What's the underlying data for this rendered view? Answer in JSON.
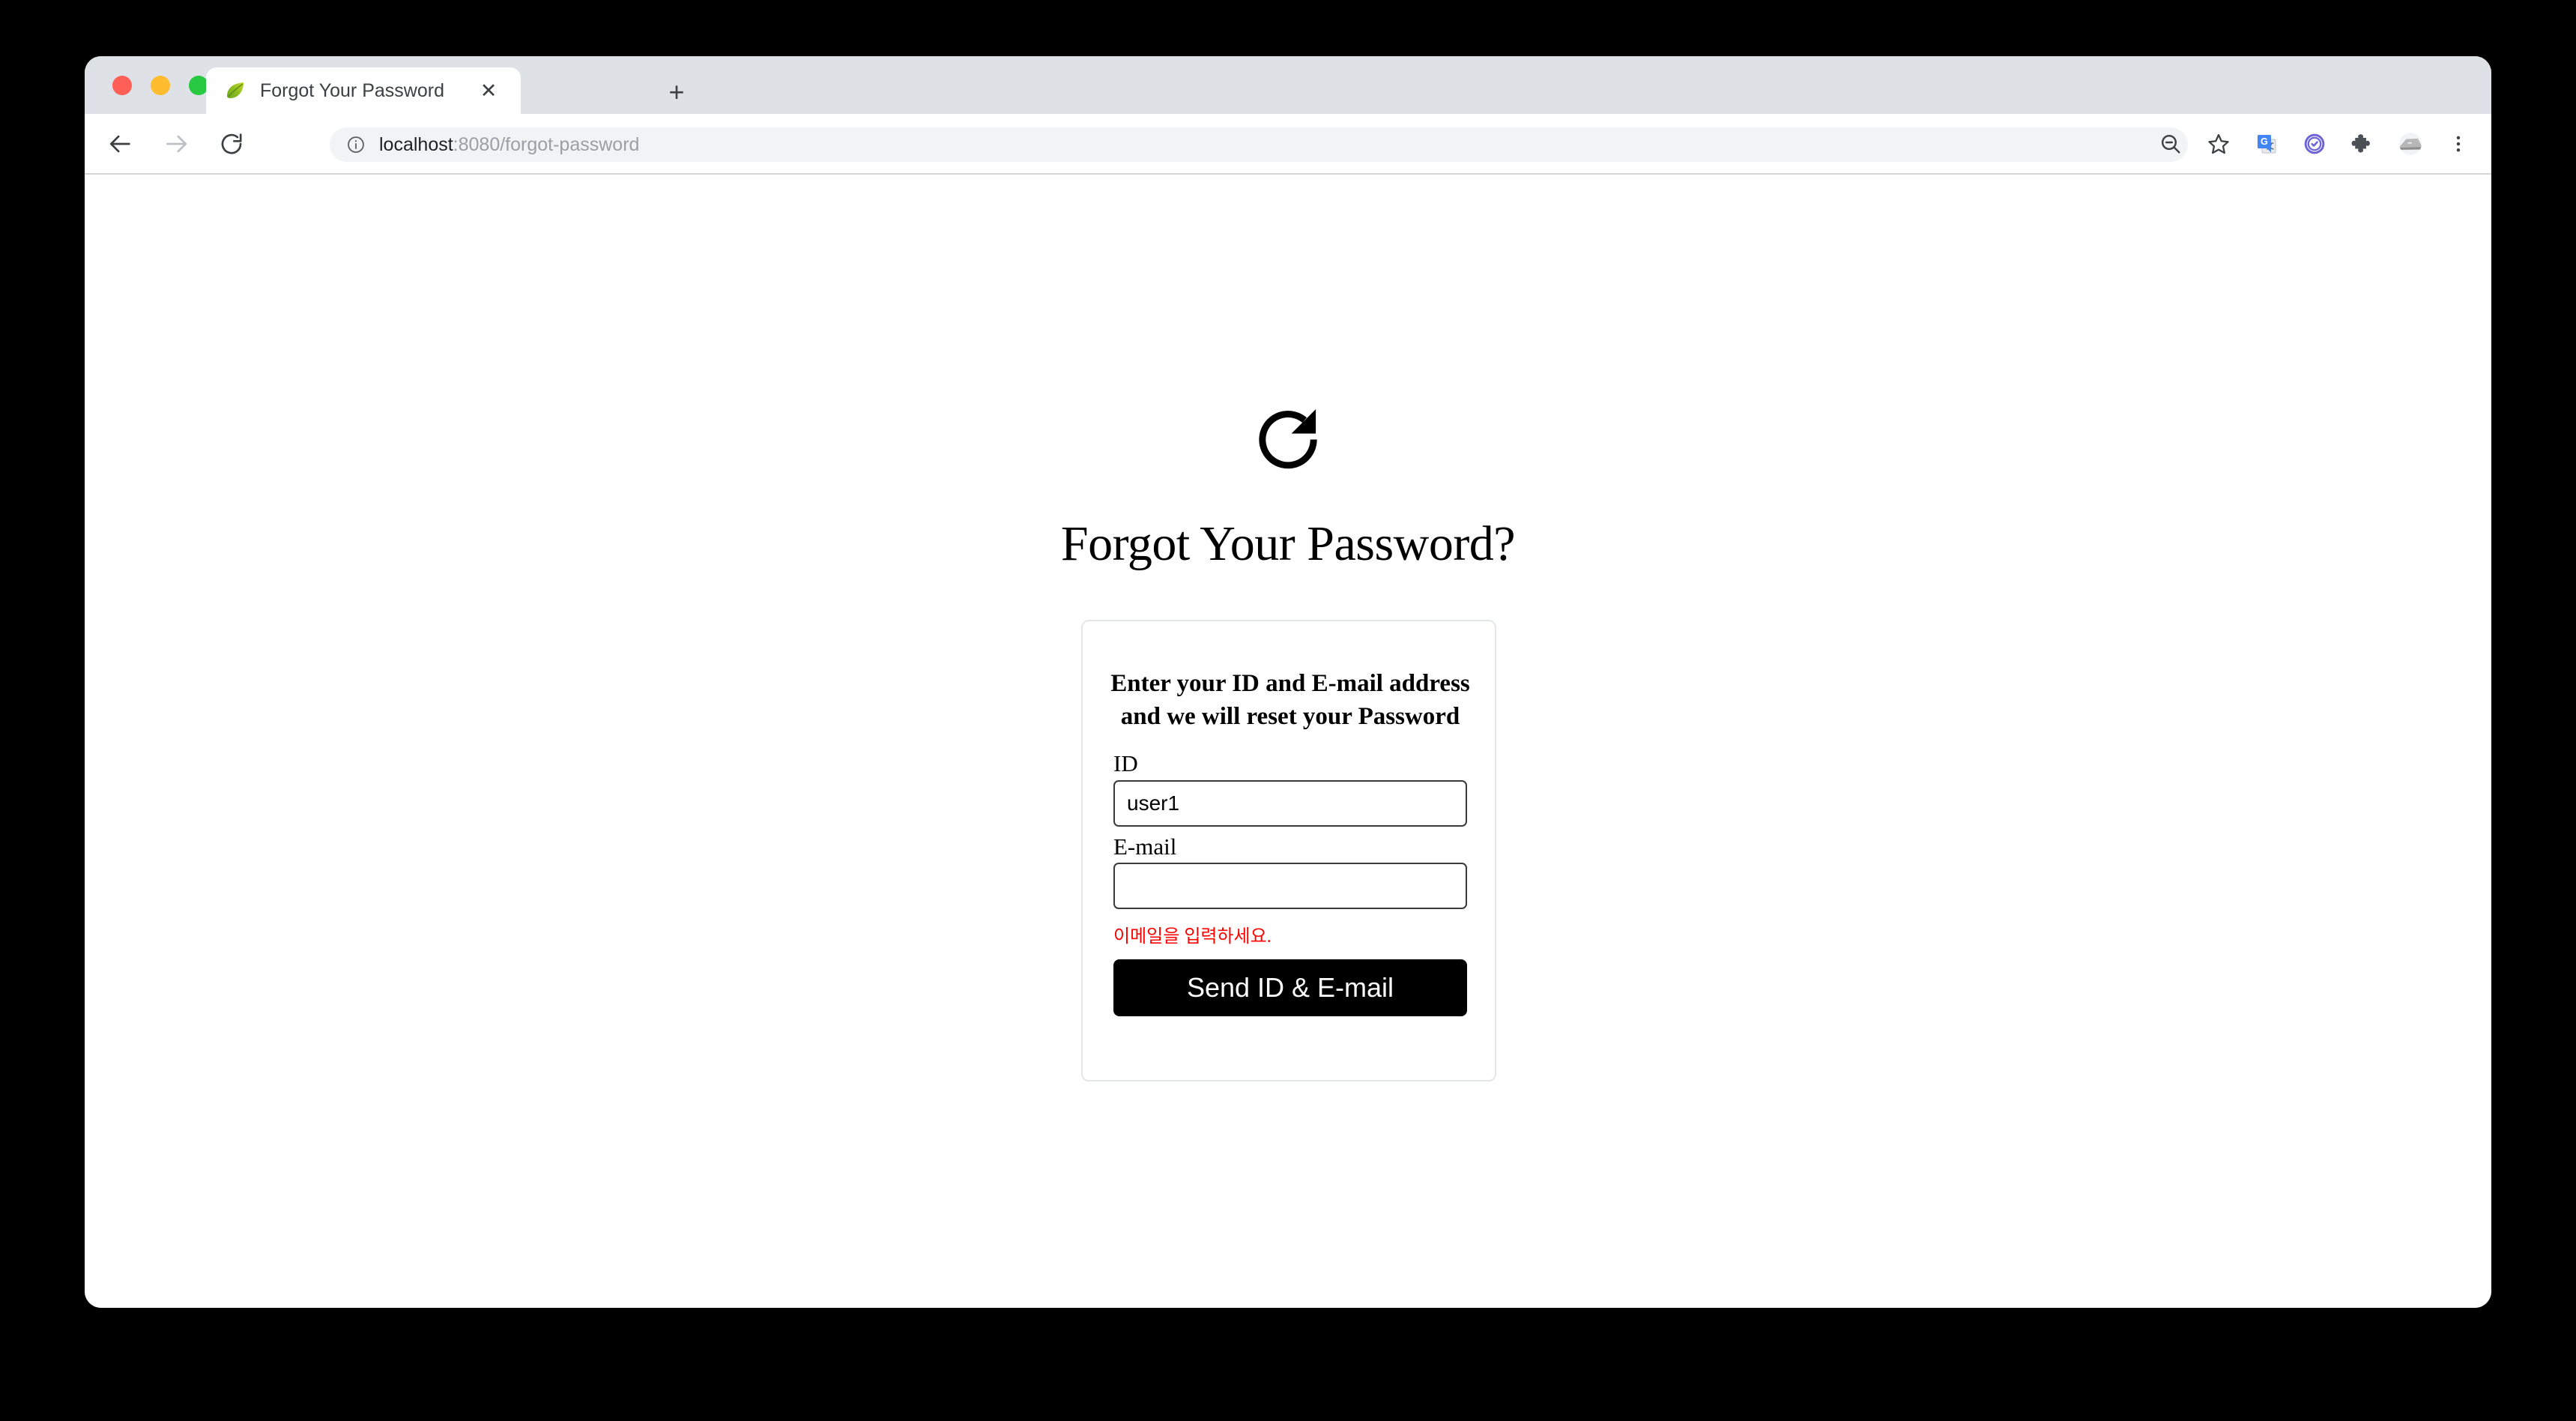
{
  "browser": {
    "traffic_lights": [
      {
        "name": "close",
        "color": "#ff5f57"
      },
      {
        "name": "minimize",
        "color": "#febc2e"
      },
      {
        "name": "maximize",
        "color": "#28c840"
      }
    ],
    "tab": {
      "title": "Forgot Your Password",
      "favicon": "spring-leaf-icon",
      "close_label": "✕"
    },
    "new_tab_label": "+",
    "nav": {
      "back_icon": "back-arrow-icon",
      "forward_icon": "forward-arrow-icon",
      "reload_icon": "reload-icon"
    },
    "address": {
      "site_info_icon": "info-circle-icon",
      "host": "localhost",
      "path": ":8080/forgot-password",
      "full_url": "localhost:8080/forgot-password"
    },
    "actions": [
      {
        "name": "zoom-out-icon",
        "label": "Zoom out"
      },
      {
        "name": "bookmark-star-icon",
        "label": "Bookmark this tab"
      },
      {
        "name": "google-translate-icon",
        "label": "Google Translate"
      },
      {
        "name": "check-circle-extension-icon",
        "label": "Extension"
      },
      {
        "name": "puzzle-piece-icon",
        "label": "Extensions"
      },
      {
        "name": "profile-avatar-icon",
        "label": "Profile"
      },
      {
        "name": "three-dot-menu-icon",
        "label": "Customize and control"
      }
    ]
  },
  "page": {
    "hero_icon": "refresh-clockwise-icon",
    "title": "Forgot Your Password?",
    "card": {
      "subtitle_line1": "Enter your ID and E-mail address",
      "subtitle_line2": "and we will reset your Password",
      "fields": [
        {
          "label": "ID",
          "value": "user1",
          "placeholder": ""
        },
        {
          "label": "E-mail",
          "value": "",
          "placeholder": ""
        }
      ],
      "error_message": "이메일을 입력하세요.",
      "submit_label": "Send ID & E-mail"
    }
  },
  "colors": {
    "error": "#ff0000",
    "button_bg": "#000000",
    "tabstrip_bg": "#dee1e6",
    "page_bg": "#ffffff",
    "desktop_bg": "#000000"
  }
}
